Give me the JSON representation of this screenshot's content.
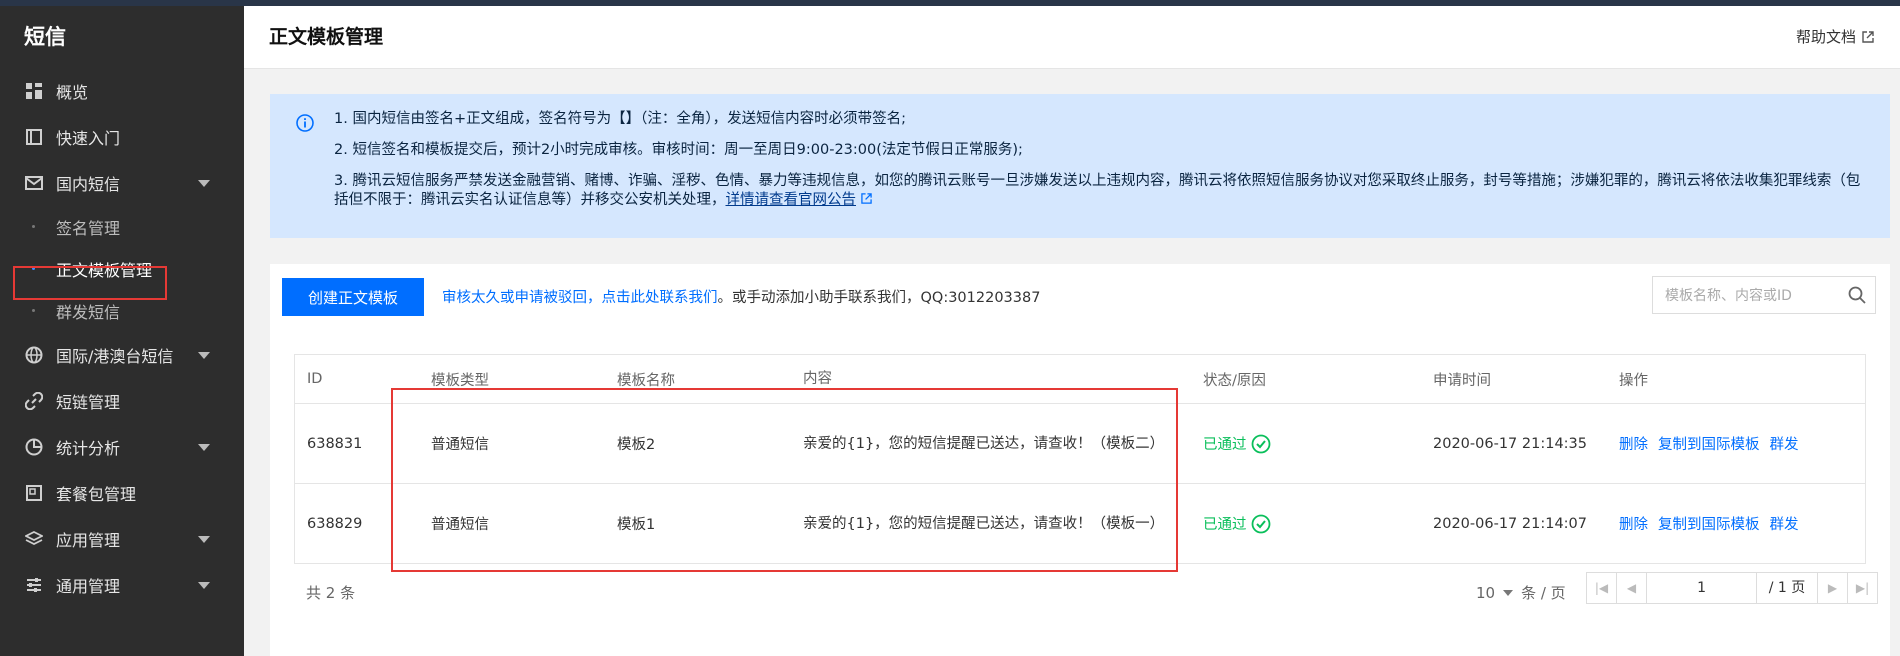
{
  "sidebar": {
    "brand": "短信",
    "items": [
      {
        "label": "概览",
        "icon": "dashboard-icon"
      },
      {
        "label": "快速入门",
        "icon": "book-icon"
      },
      {
        "label": "国内短信",
        "icon": "mail-icon",
        "expanded": true,
        "children": [
          "签名管理",
          "正文模板管理",
          "群发短信"
        ]
      },
      {
        "label": "国际/港澳台短信",
        "icon": "globe-icon"
      },
      {
        "label": "短链管理",
        "icon": "link-icon"
      },
      {
        "label": "统计分析",
        "icon": "pie-chart-icon"
      },
      {
        "label": "套餐包管理",
        "icon": "package-icon"
      },
      {
        "label": "应用管理",
        "icon": "layers-icon"
      },
      {
        "label": "通用管理",
        "icon": "settings-sliders-icon"
      }
    ],
    "active_child": "正文模板管理"
  },
  "header": {
    "title": "正文模板管理",
    "help_label": "帮助文档"
  },
  "notice": {
    "line1": "1. 国内短信由签名+正文组成，签名符号为【】（注：全角），发送短信内容时必须带签名;",
    "line2": "2. 短信签名和模板提交后，预计2小时完成审核。审核时间：周一至周日9:00-23:00(法定节假日正常服务);",
    "line3": "3. 腾讯云短信服务严禁发送金融营销、赌博、诈骗、淫秽、色情、暴力等违规信息，如您的腾讯云账号一旦涉嫌发送以上违规内容，腾讯云将依照短信服务协议对您采取终止服务，封号等措施；涉嫌犯罪的，腾讯云将依法收集犯罪线索（包括但不限于：腾讯云实名认证信息等）并移交公安机关处理，",
    "link": "详情请查看官网公告"
  },
  "toolbar": {
    "create_label": "创建正文模板",
    "hint_blue": "审核太久或申请被驳回，点击此处联系我们",
    "hint_rest": "。或手动添加小助手联系我们，QQ:3012203387",
    "search_placeholder": "模板名称、内容或ID"
  },
  "table": {
    "headers": [
      "ID",
      "模板类型",
      "模板名称",
      "内容",
      "状态/原因",
      "申请时间",
      "操作"
    ],
    "rows": [
      {
        "id": "638831",
        "type": "普通短信",
        "name": "模板2",
        "content": "亲爱的{1}，您的短信提醒已送达，请查收！（模板二）",
        "status": "已通过",
        "time": "2020-06-17 21:14:35",
        "ops": [
          "删除",
          "复制到国际模板",
          "群发"
        ]
      },
      {
        "id": "638829",
        "type": "普通短信",
        "name": "模板1",
        "content": "亲爱的{1}，您的短信提醒已送达，请查收！（模板一）",
        "status": "已通过",
        "time": "2020-06-17 21:14:07",
        "ops": [
          "删除",
          "复制到国际模板",
          "群发"
        ]
      }
    ]
  },
  "footer": {
    "total": "共 2 条",
    "page_size": "10",
    "page_size_unit": "条 / 页",
    "current_page": "1",
    "total_pages": "/ 1 页"
  },
  "colors": {
    "accent": "#006eff",
    "success": "#0abf5b",
    "highlight": "#e53935",
    "sidebar": "#2d2d2d"
  }
}
